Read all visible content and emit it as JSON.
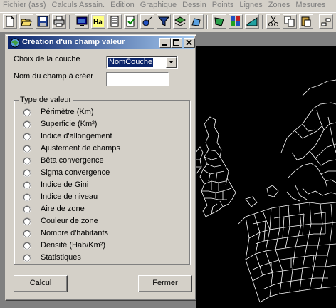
{
  "menu": [
    "Fichier (ass)",
    "Calculs Assain.",
    "Edition",
    "Graphique",
    "Dessin",
    "Points",
    "Lignes",
    "Zones",
    "Mesures"
  ],
  "toolbar": {
    "icons": [
      "new-icon",
      "open-icon",
      "save-icon",
      "print-icon",
      "screen-icon",
      "text-ha-icon",
      "page-icon",
      "check-page-icon",
      "node-icon",
      "filter-icon",
      "layers-icon",
      "polygon-edit-icon",
      "polygon-select-icon",
      "zone-color-icon",
      "cut-icon",
      "copy-icon",
      "paste-icon",
      "link-icon"
    ]
  },
  "dialog": {
    "title": "Création d'un champ valeur",
    "layer_label": "Choix de la couche",
    "layer_value": "NomCouche",
    "field_name_label": "Nom du champ à créer",
    "field_name_value": "",
    "value_type_group": "Type de valeur",
    "value_types": [
      "Périmètre (Km)",
      "Superficie (Km²)",
      "Indice d'allongement",
      "Ajustement de champs",
      "Bêta convergence",
      "Sigma convergence",
      "Indice de Gini",
      "Indice de niveau",
      "Aire de zone",
      "Couleur de zone",
      "Nombre d'habitants",
      "Densité (Hab/Km²)",
      "Statistiques"
    ],
    "calc_button": "Calcul",
    "close_button": "Fermer"
  },
  "colors": {
    "window_face": "#d4d0c8",
    "title_active_start": "#0a246a",
    "title_active_end": "#a6caf0",
    "map_background": "#000000",
    "map_lines": "#ffffff"
  }
}
